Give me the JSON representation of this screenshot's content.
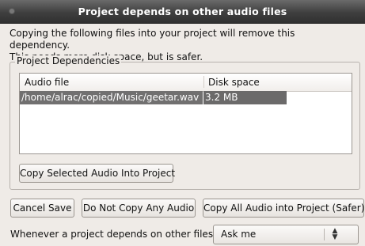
{
  "window": {
    "title": "Project depends on other audio files"
  },
  "message": {
    "line1": "Copying the following files into your project will remove this dependency.",
    "line2": "This needs more disk space, but is safer."
  },
  "dependencies": {
    "group_label": "Project Dependencies",
    "columns": [
      "Audio file",
      "Disk space"
    ],
    "rows": [
      {
        "file": "/home/alrac/copied/Music/geetar.wav",
        "size": "3.2 MB",
        "selected": true
      }
    ],
    "copy_selected_label": "Copy Selected Audio Into Project"
  },
  "buttons": {
    "cancel_save": "Cancel Save",
    "do_not_copy": "Do Not Copy Any Audio",
    "copy_all": "Copy All Audio into Project (Safer)"
  },
  "policy": {
    "label": "Whenever a project depends on other files:",
    "selected": "Ask me"
  },
  "icons": {
    "window_menu": "window-menu-icon",
    "combo_arrows": "updown-chevron-icon"
  },
  "colors": {
    "titlebar": "#3f3f3f",
    "selection": "#717070",
    "window_bg": "#efebe7"
  }
}
